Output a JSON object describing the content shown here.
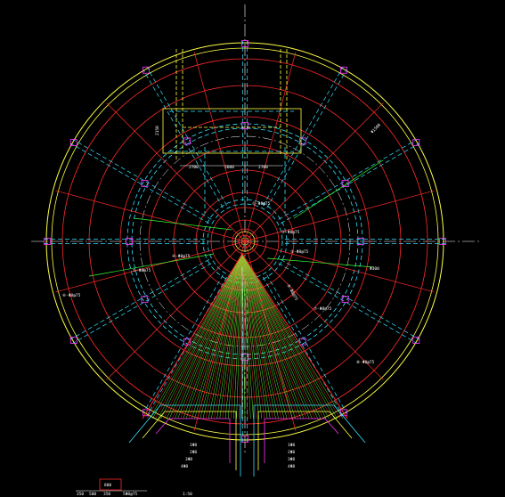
{
  "drawing": {
    "colors": {
      "background": "#000000",
      "outer_ring": "#ffff44",
      "red_circles": "#ff2a2a",
      "cyan_dashed": "#33e0ff",
      "white_axis": "#ffffff",
      "magenta": "#ff33ff",
      "green": "#33ff33",
      "yellow_dashed": "#ffff44",
      "fan_green": "#66ff33",
      "fan_red": "#ff3333"
    },
    "dims_top": [
      "2700",
      "2600",
      "2700"
    ],
    "dim_vertical": "2150",
    "ring_labels": [
      "①-Φ8@75",
      "②-Φ8@75",
      "③-Φ8@75",
      "④-Φ8@75",
      "⑤-Φ8@75",
      "⑥-Φ8@75",
      "⑦-Φ8@75",
      "⑧-Φ8@75",
      "⑨-Φ8@75"
    ],
    "center_note": "Φ300",
    "right_note": "Φ1500",
    "left_legend": [
      "1Φ8",
      "2Φ8",
      "3Φ8",
      "4Φ8"
    ],
    "right_legend": [
      "1Φ8",
      "2Φ8",
      "3Φ8",
      "4Φ8"
    ],
    "bottom_scale": [
      "800",
      "350",
      "500",
      "350"
    ],
    "bottom_note": "1:50",
    "bottom_label": "5Φ8@75"
  }
}
